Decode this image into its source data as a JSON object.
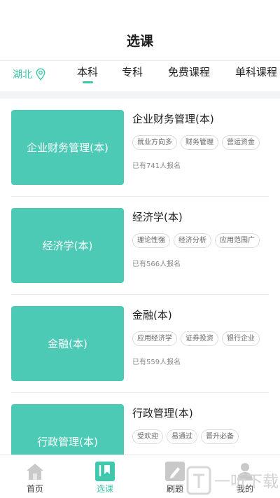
{
  "header": {
    "title": "选课"
  },
  "region": {
    "label": "湖北",
    "icon": "location-pin-icon"
  },
  "tabs": [
    {
      "label": "本科",
      "active": true
    },
    {
      "label": "专科",
      "active": false
    },
    {
      "label": "免费课程",
      "active": false
    },
    {
      "label": "单科课程",
      "active": false
    }
  ],
  "courses": [
    {
      "thumb_label": "企业财务管理(本)",
      "title": "企业财务管理(本)",
      "tags": [
        "就业方向多",
        "财务管理",
        "营运资金"
      ],
      "enrolled": "已有741人报名"
    },
    {
      "thumb_label": "经济学(本)",
      "title": "经济学(本)",
      "tags": [
        "理论性强",
        "经济分析",
        "应用范围广"
      ],
      "enrolled": "已有566人报名"
    },
    {
      "thumb_label": "金融(本)",
      "title": "金融(本)",
      "tags": [
        "应用经济学",
        "证券投资",
        "银行企业"
      ],
      "enrolled": "已有559人报名"
    },
    {
      "thumb_label": "行政管理(本)",
      "title": "行政管理(本)",
      "tags": [
        "受欢迎",
        "易通过",
        "晋升必备"
      ],
      "enrolled": ""
    }
  ],
  "nav": [
    {
      "label": "首页",
      "icon": "home-icon",
      "active": false
    },
    {
      "label": "选课",
      "icon": "bookmark-icon",
      "active": true
    },
    {
      "label": "刷题",
      "icon": "pencil-icon",
      "active": false
    },
    {
      "label": "我的",
      "icon": "user-icon",
      "active": false
    }
  ],
  "watermark": {
    "text": "一听下载"
  },
  "colors": {
    "accent": "#3ec8ac",
    "thumb": "#4ccab6",
    "band": "#f3f4f6"
  }
}
